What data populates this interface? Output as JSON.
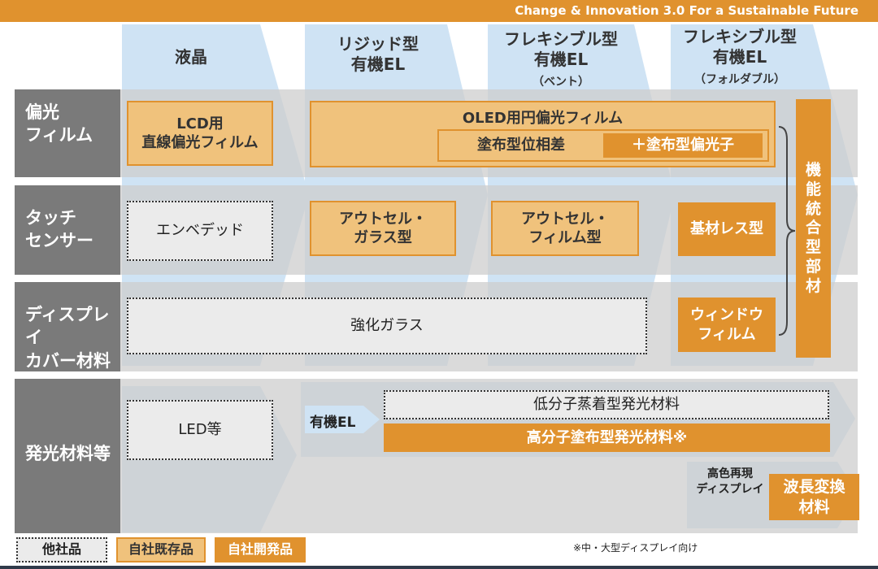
{
  "header": {
    "title": "Change & Innovation 3.0   For a Sustainable Future"
  },
  "columns": [
    {
      "name": "液晶",
      "sub": ""
    },
    {
      "name": "リジッド型\n有機EL",
      "sub": ""
    },
    {
      "name": "フレキシブル型\n有機EL",
      "sub": "（ベント）"
    },
    {
      "name": "フレキシブル型\n有機EL",
      "sub": "（フォルダブル）"
    }
  ],
  "rows": {
    "polarizer": "偏光\nフィルム",
    "touch": "タッチ\nセンサー",
    "cover": "ディスプレイ\nカバー材料",
    "emitter": "発光材料等"
  },
  "boxes": {
    "lcd_polarizer": "LCD用\n直線偏光フィルム",
    "oled_polarizer": "OLED用円偏光フィルム",
    "coated_retarder": "塗布型位相差",
    "coated_polarizer": "＋塗布型偏光子",
    "embedded": "エンベデッド",
    "outcell_glass": "アウトセル・\nガラス型",
    "outcell_film": "アウトセル・\nフィルム型",
    "substrateless": "基材レス型",
    "tempered_glass": "強化ガラス",
    "window_film": "ウィンドウ\nフィルム",
    "integrated": [
      "機",
      "能",
      "統",
      "合",
      "型",
      "部",
      "材"
    ],
    "led": "LED等",
    "oled_tag": "有機EL",
    "small_molecule": "低分子蒸着型発光材料",
    "polymer": "高分子塗布型発光材料※",
    "high_color": "高色再現\nディスプレイ",
    "wavelength": "波長変換\n材料"
  },
  "legend": {
    "others": "他社品",
    "existing": "自社既存品",
    "developing": "自社開発品"
  },
  "footnote": "※中・大型ディスプレイ向け",
  "colors": {
    "orange": "#e0922e",
    "tan": "#f0c27c",
    "gray_label": "#7a7a7a",
    "row_bg": "#e2e2e2",
    "arrow_blue": "#cfe3f4"
  }
}
